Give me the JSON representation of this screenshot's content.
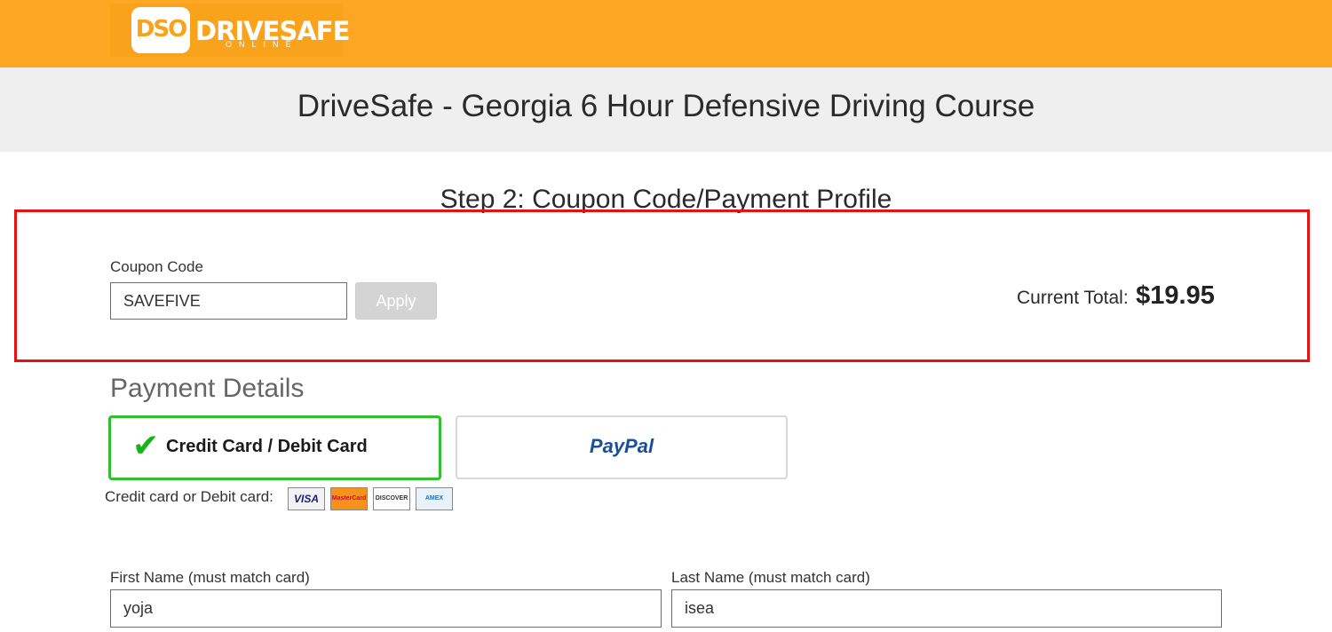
{
  "header": {
    "logo": {
      "mark": "DSO",
      "wordmark": "DRIVESAFE",
      "subtext": "ONLINE",
      "color": "#f9a21b"
    },
    "accent_color": "#fca624"
  },
  "banner": {
    "title": "DriveSafe - Georgia 6 Hour Defensive Driving Course"
  },
  "step": {
    "title": "Step 2: Coupon Code/Payment Profile"
  },
  "coupon": {
    "label": "Coupon Code",
    "value": "SAVEFIVE",
    "apply_label": "Apply",
    "current_total_label": "Current Total:",
    "current_total_value": "$19.95"
  },
  "payment": {
    "heading": "Payment Details",
    "options": [
      {
        "label": "Credit Card / Debit Card",
        "selected": true,
        "icon": "check-icon"
      },
      {
        "label": "PayPal",
        "selected": false
      }
    ],
    "cards_caption": "Credit card or Debit card:",
    "card_logos": [
      {
        "name": "visa",
        "text": "VISA"
      },
      {
        "name": "mastercard",
        "text": "MasterCard"
      },
      {
        "name": "discover",
        "text": "DISCOVER"
      },
      {
        "name": "amex",
        "text": "AMEX"
      }
    ]
  },
  "form": {
    "first_name_label": "First Name (must match card)",
    "first_name_value": "yoja",
    "last_name_label": "Last Name (must match card)",
    "last_name_value": "isea"
  },
  "colors": {
    "selected_border": "#2fbf2f",
    "highlight_border": "#e81111",
    "paypal_blue": "#1b4f9c"
  }
}
